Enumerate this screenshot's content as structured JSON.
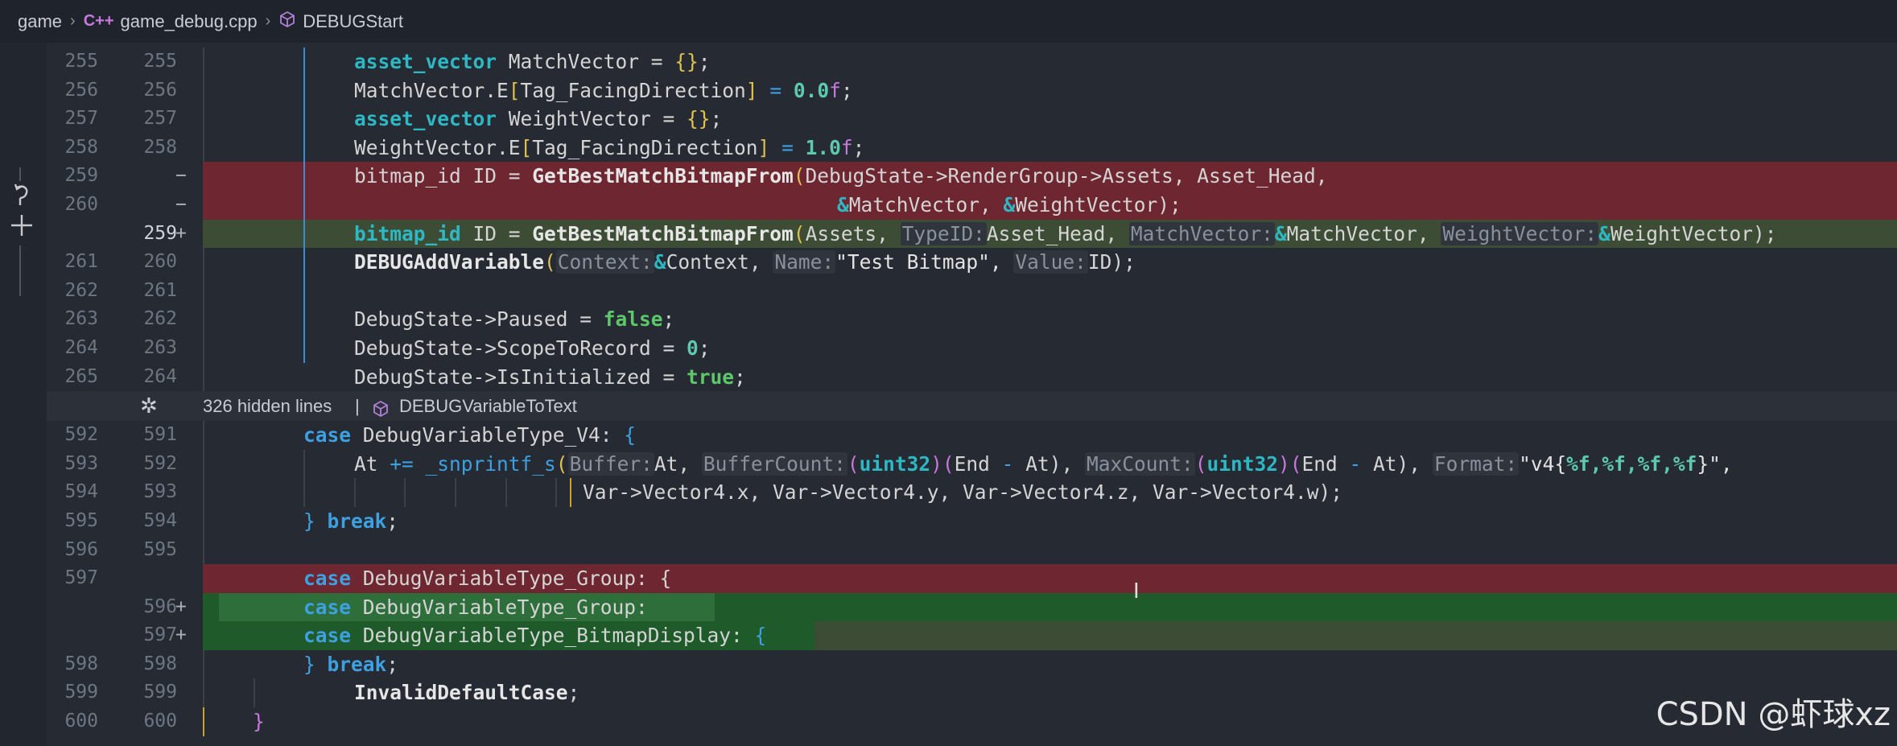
{
  "breadcrumb": {
    "root": "game",
    "file_icon_text": "C++",
    "file": "game_debug.cpp",
    "symbol": "DEBUGStart"
  },
  "left_gutter": {
    "revert_icon": "undo-arrow-icon",
    "stage_icon": "plus-icon"
  },
  "lines": [
    {
      "old": "255",
      "new": "255",
      "mark": "",
      "kind": "ctx"
    },
    {
      "old": "256",
      "new": "256",
      "mark": "",
      "kind": "ctx"
    },
    {
      "old": "257",
      "new": "257",
      "mark": "",
      "kind": "ctx"
    },
    {
      "old": "258",
      "new": "258",
      "mark": "",
      "kind": "ctx"
    },
    {
      "old": "259",
      "new": "",
      "mark": "−",
      "kind": "del"
    },
    {
      "old": "260",
      "new": "",
      "mark": "−",
      "kind": "del"
    },
    {
      "old": "",
      "new": "259",
      "mark": "+",
      "kind": "ins"
    },
    {
      "old": "261",
      "new": "260",
      "mark": "",
      "kind": "ctx"
    },
    {
      "old": "262",
      "new": "261",
      "mark": "",
      "kind": "ctx"
    },
    {
      "old": "263",
      "new": "262",
      "mark": "",
      "kind": "ctx"
    },
    {
      "old": "264",
      "new": "263",
      "mark": "",
      "kind": "ctx"
    },
    {
      "old": "265",
      "new": "264",
      "mark": "",
      "kind": "ctx"
    }
  ],
  "hidden": {
    "text": "326 hidden lines",
    "divider": "|",
    "symbol": "DEBUGVariableToText",
    "icon": "unfold-icon"
  },
  "lines2": [
    {
      "old": "592",
      "new": "591",
      "mark": "",
      "kind": "ctx"
    },
    {
      "old": "593",
      "new": "592",
      "mark": "",
      "kind": "ctx"
    },
    {
      "old": "594",
      "new": "593",
      "mark": "",
      "kind": "ctx"
    },
    {
      "old": "595",
      "new": "594",
      "mark": "",
      "kind": "ctx"
    },
    {
      "old": "596",
      "new": "595",
      "mark": "",
      "kind": "ctx"
    },
    {
      "old": "597",
      "new": "",
      "mark": "",
      "kind": "del"
    },
    {
      "old": "",
      "new": "596",
      "mark": "+",
      "kind": "ins2"
    },
    {
      "old": "",
      "new": "597",
      "mark": "+",
      "kind": "ins"
    },
    {
      "old": "598",
      "new": "598",
      "mark": "",
      "kind": "ctx"
    },
    {
      "old": "599",
      "new": "599",
      "mark": "",
      "kind": "ctx"
    },
    {
      "old": "600",
      "new": "600",
      "mark": "",
      "kind": "ctx"
    }
  ],
  "code": {
    "l255_type": "asset_vector",
    "l255_rest": " MatchVector = ",
    "l255_braces": "{}",
    "l256_a": "MatchVector.E",
    "l256_b": "Tag_FacingDirection",
    "l256_num": "0.0",
    "l256_f": "f",
    "l257_type": "asset_vector",
    "l257_rest": " WeightVector = ",
    "l257_braces": "{}",
    "l258_a": "WeightVector.E",
    "l258_b": "Tag_FacingDirection",
    "l258_num": "1.0",
    "l258_f": "f",
    "l259_a": "bitmap_id ID = ",
    "l259_fn": "GetBestMatchBitmapFrom",
    "l259_args": "DebugState->RenderGroup->Assets, Asset_Head,",
    "l260_args": "MatchVector, ",
    "l260_args2": "WeightVector);",
    "n259_type": "bitmap_id",
    "n259_a": " ID = ",
    "n259_fn": "GetBestMatchBitmapFrom",
    "n259_arg1": "Assets, ",
    "n259_hint1": "TypeID:",
    "n259_arg2": "Asset_Head, ",
    "n259_hint2": "MatchVector:",
    "n259_arg3": "MatchVector, ",
    "n259_hint3": "WeightVector:",
    "n259_arg4": "WeightVector);",
    "l261_fn": "DEBUGAddVariable",
    "l261_hint1": "Context:",
    "l261_arg1": "Context, ",
    "l261_hint2": "Name:",
    "l261_str": "\"Test Bitmap\", ",
    "l261_hint3": "Value:",
    "l261_arg3": "ID);",
    "l263_a": "DebugState->Paused = ",
    "l263_bool": "false",
    "l264_a": "DebugState->ScopeToRecord = ",
    "l264_num": "0",
    "l265_a": "DebugState->IsInitialized = ",
    "l265_bool": "true",
    "l592_kw": "case",
    "l592_a": " DebugVariableType_V4: ",
    "l592_brace": "{",
    "l593_a": "At ",
    "l593_op": "+=",
    "l593_fn": " _snprintf_s",
    "l593_hint1": "Buffer:",
    "l593_arg1": "At, ",
    "l593_hint2": "BufferCount:",
    "l593_arg2a": "uint32",
    "l593_arg2b": "End ",
    "l593_arg2c": " At), ",
    "l593_hint3": "MaxCount:",
    "l593_arg3a": "uint32",
    "l593_arg3b": "End ",
    "l593_arg3c": " At), ",
    "l593_hint4": "Format:",
    "l593_str1": "\"v4{",
    "l593_fmt": "%f,%f,%f,%f",
    "l593_str2": "}\",",
    "l594_a": "Var->Vector4.x, Var->Vector4.y, Var->Vector4.z, Var->Vector4.w);",
    "l595_brace": "} ",
    "l595_kw": "break",
    "l597_kw": "case",
    "l597_a": " DebugVariableType_Group: {",
    "n596_kw": "case",
    "n596_a": " DebugVariableType_Group:",
    "n597_kw": "case",
    "n597_a": " DebugVariableType_BitmapDisplay: ",
    "n597_brace": "{",
    "l598_brace": "} ",
    "l598_kw": "break",
    "l599_fn": "InvalidDefaultCase",
    "l600_brace": "}"
  },
  "watermark": "CSDN @虾球xz"
}
